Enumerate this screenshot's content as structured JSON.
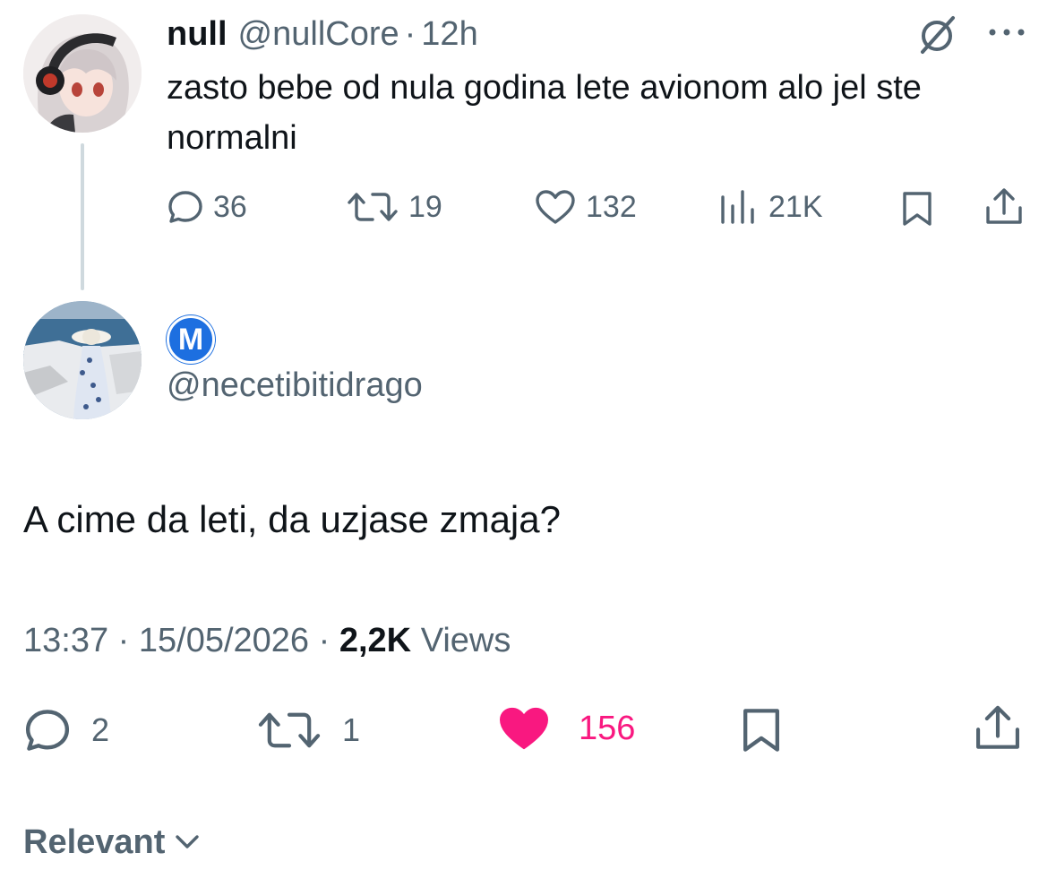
{
  "parent_tweet": {
    "name": "null",
    "handle": "@nullCore",
    "separator": "·",
    "time": "12h",
    "text": "zasto bebe od nula godina lete avionom alo jel ste normalni",
    "actions": {
      "replies": "36",
      "retweets": "19",
      "likes": "132",
      "views": "21K"
    },
    "icons": [
      "grok-icon",
      "more-icon",
      "reply-icon",
      "retweet-icon",
      "like-icon",
      "views-icon",
      "bookmark-icon",
      "share-icon"
    ]
  },
  "reply_tweet": {
    "badge_letter": "M",
    "handle": "@necetibitidrago",
    "text": "A cime da leti, da uzjase zmaja?",
    "time": "13:37",
    "sep1": "·",
    "date": "15/05/2026",
    "sep2": "·",
    "views_count": "2,2K",
    "views_label": "Views",
    "actions": {
      "replies": "2",
      "retweets": "1",
      "likes": "156",
      "liked": true
    }
  },
  "sort": {
    "label": "Relevant"
  },
  "colors": {
    "text_primary": "#0f1419",
    "text_secondary": "#536471",
    "like_active": "#f91880",
    "badge_blue": "#1d6fe0",
    "thread_line": "#cfd9de"
  }
}
